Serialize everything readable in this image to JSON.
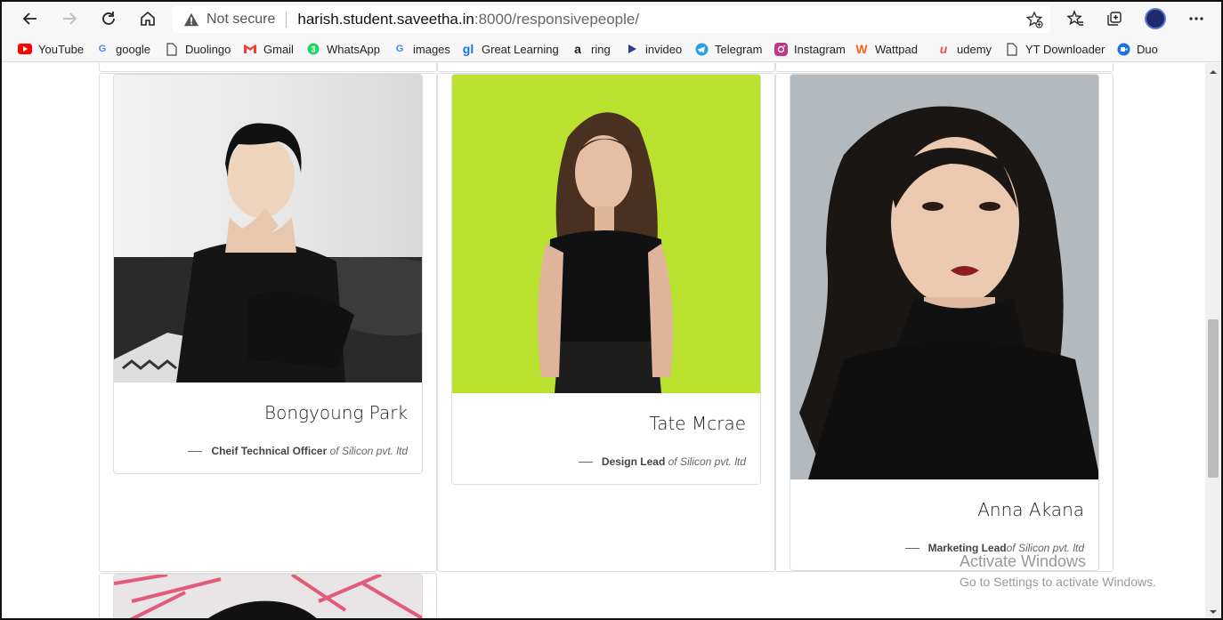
{
  "address_bar": {
    "security_label": "Not secure",
    "host": "harish.student.saveetha.in",
    "path": ":8000/responsivepeople/"
  },
  "bookmarks": [
    {
      "label": "YouTube",
      "icon": "youtube-icon",
      "color": "#ff0000"
    },
    {
      "label": "google",
      "icon": "google-icon",
      "color": "#4285f4"
    },
    {
      "label": "Duolingo",
      "icon": "page-icon",
      "color": "#555555"
    },
    {
      "label": "Gmail",
      "icon": "gmail-icon",
      "color": "#ea4335"
    },
    {
      "label": "WhatsApp",
      "icon": "whatsapp-icon",
      "color": "#25d366"
    },
    {
      "label": "images",
      "icon": "google-icon",
      "color": "#4285f4"
    },
    {
      "label": "Great Learning",
      "icon": "great-learning-icon",
      "color": "#1a73e8"
    },
    {
      "label": "ring",
      "icon": "amazon-icon",
      "color": "#222222"
    },
    {
      "label": "invideo",
      "icon": "invideo-icon",
      "color": "#333a8a"
    },
    {
      "label": "Telegram",
      "icon": "telegram-icon",
      "color": "#2aa1da"
    },
    {
      "label": "Instagram",
      "icon": "instagram-icon",
      "color": "#c13584"
    },
    {
      "label": "Wattpad",
      "icon": "wattpad-icon",
      "color": "#ff6122"
    },
    {
      "label": "udemy",
      "icon": "udemy-icon",
      "color": "#ec5252"
    },
    {
      "label": "YT Downloader",
      "icon": "page-icon",
      "color": "#555555"
    },
    {
      "label": "Duo",
      "icon": "duo-icon",
      "color": "#1a73e8"
    }
  ],
  "people": [
    {
      "name": "Bongyoung Park",
      "role": "Cheif Technical Officer",
      "company": "of Silicon pvt. ltd"
    },
    {
      "name": "Tate Mcrae",
      "role": "Design Lead",
      "company": "of Silicon pvt. ltd"
    },
    {
      "name": "Anna Akana",
      "role": "Marketing Lead",
      "company": "of Silicon pvt. ltd"
    }
  ],
  "watermark": {
    "line1": "Activate Windows",
    "line2": "Go to Settings to activate Windows."
  }
}
